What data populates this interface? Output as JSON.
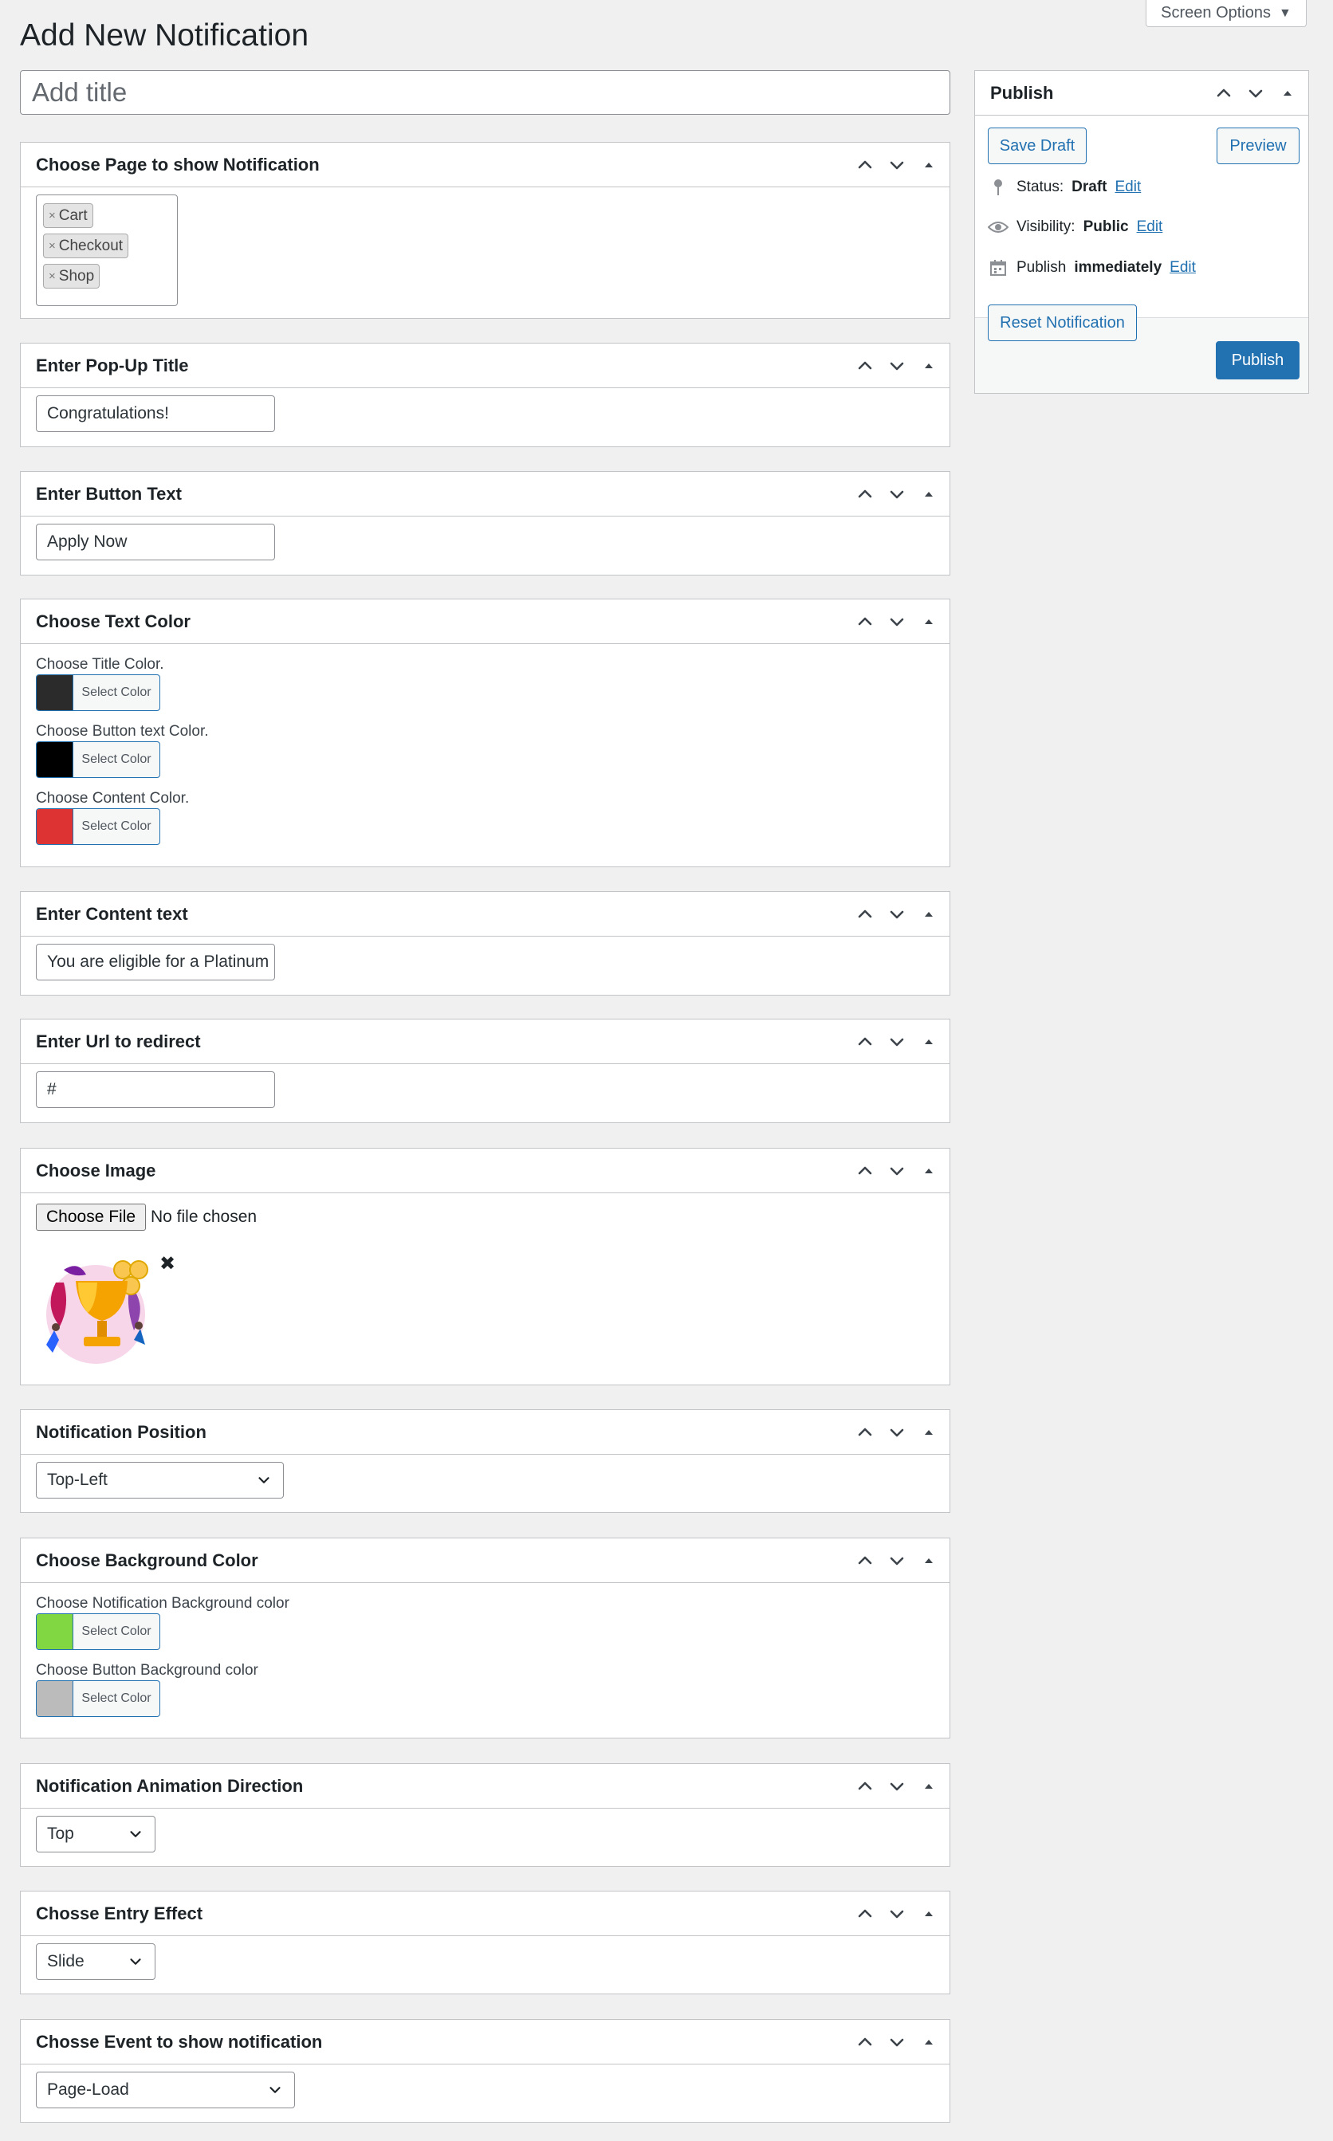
{
  "page": {
    "title": "Add New Notification",
    "screen_options": "Screen Options"
  },
  "title_field": {
    "placeholder": "Add title"
  },
  "boxes": {
    "pages": {
      "title": "Choose Page to show Notification",
      "tags": [
        "Cart",
        "Checkout",
        "Shop"
      ],
      "remove_glyph": "×"
    },
    "popup_title": {
      "title": "Enter Pop-Up Title",
      "value": "Congratulations!"
    },
    "button_text": {
      "title": "Enter Button Text",
      "value": "Apply Now"
    },
    "text_color": {
      "title": "Choose Text Color",
      "items": [
        {
          "label": "Choose Title Color.",
          "button": "Select Color",
          "color": "#2b2b2b"
        },
        {
          "label": "Choose Button text Color.",
          "button": "Select Color",
          "color": "#000000"
        },
        {
          "label": "Choose Content Color.",
          "button": "Select Color",
          "color": "#dd3333"
        }
      ]
    },
    "content_text": {
      "title": "Enter Content text",
      "value": "You are eligible for a Platinum"
    },
    "url": {
      "title": "Enter Url to redirect",
      "value": "#"
    },
    "image": {
      "title": "Choose Image",
      "button": "Choose File",
      "status": "No file chosen",
      "remove": "✖"
    },
    "position": {
      "title": "Notification Position",
      "selected": "Top-Left"
    },
    "bg_color": {
      "title": "Choose Background Color",
      "items": [
        {
          "label": "Choose Notification Background color",
          "button": "Select Color",
          "color": "#81d742"
        },
        {
          "label": "Choose Button Background color",
          "button": "Select Color",
          "color": "#bbbbbb"
        }
      ]
    },
    "animation": {
      "title": "Notification Animation Direction",
      "selected": "Top"
    },
    "entry_effect": {
      "title": "Chosse Entry Effect",
      "selected": "Slide"
    },
    "event": {
      "title": "Chosse Event to show notification",
      "selected": "Page-Load"
    }
  },
  "publish": {
    "title": "Publish",
    "save_draft": "Save Draft",
    "preview": "Preview",
    "status_label": "Status:",
    "status_value": "Draft",
    "visibility_label": "Visibility:",
    "visibility_value": "Public",
    "publish_label": "Publish",
    "publish_value": "immediately",
    "edit": "Edit",
    "reset": "Reset Notification",
    "publish_button": "Publish"
  },
  "colors": {
    "accent": "#2271b1",
    "background": "#f0f0f1",
    "border": "#c3c4c7"
  }
}
